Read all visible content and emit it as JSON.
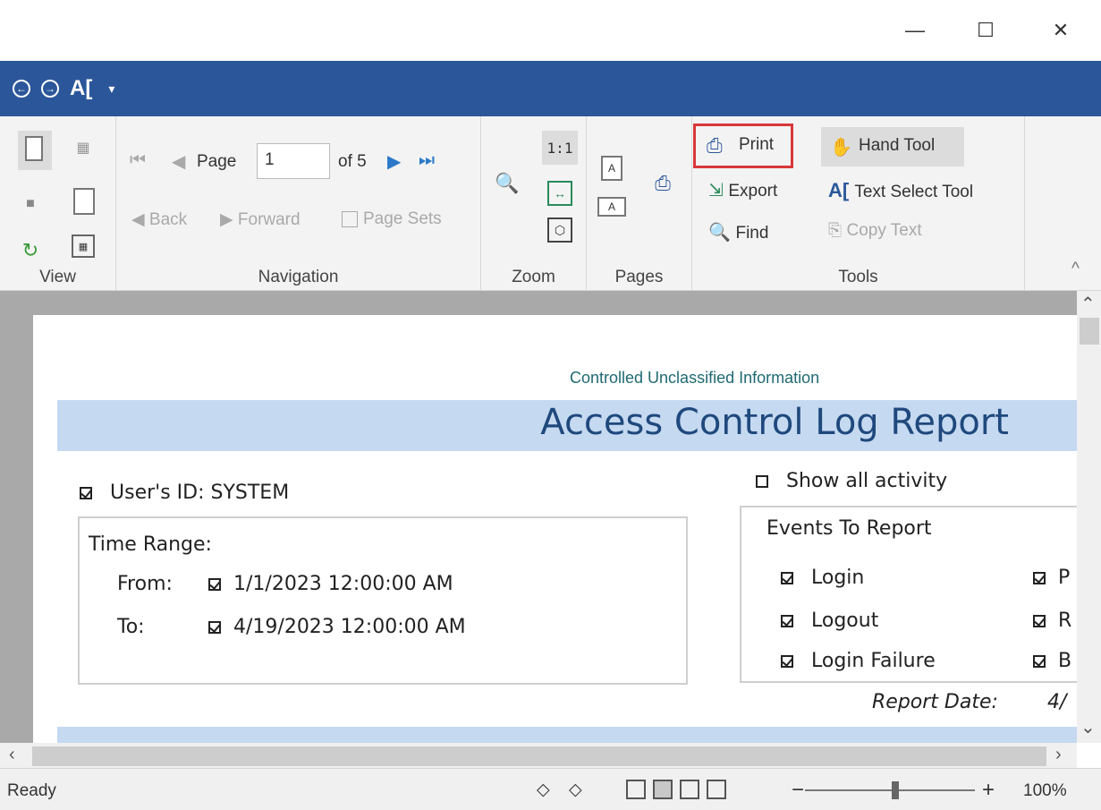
{
  "window": {
    "minimize": "—",
    "maximize": "☐",
    "close": "✕"
  },
  "qat": {
    "back": "←",
    "forward": "→",
    "text_tool": "A[",
    "dropdown": "▾"
  },
  "ribbon": {
    "groups": {
      "view": "View",
      "navigation": "Navigation",
      "zoom": "Zoom",
      "pages": "Pages",
      "tools": "Tools"
    },
    "navigation": {
      "page_label": "Page",
      "page_value": "1",
      "of_label": "of 5",
      "back": "Back",
      "forward": "Forward",
      "page_sets": "Page Sets"
    },
    "zoom": {
      "actual_size": "1:1"
    },
    "tools": {
      "print": "Print",
      "export": "Export",
      "find": "Find",
      "hand_tool": "Hand Tool",
      "text_select_tool": "Text Select Tool",
      "copy_text": "Copy Text"
    },
    "collapse": "^"
  },
  "document": {
    "classification": "Controlled Unclassified Information",
    "title": "Access Control Log Report",
    "user_id": "User's ID: SYSTEM",
    "show_all_activity": "Show all activity",
    "time_range": {
      "heading": "Time Range:",
      "from_label": "From:",
      "from_value": "1/1/2023 12:00:00 AM",
      "to_label": "To:",
      "to_value": "4/19/2023 12:00:00 AM"
    },
    "events": {
      "heading": "Events To Report",
      "items": [
        "Login",
        "Logout",
        "Login Failure"
      ],
      "right_items": [
        "P",
        "R",
        "B"
      ]
    },
    "report_date_label": "Report Date:",
    "report_date_value": "4/"
  },
  "status": {
    "text": "Ready",
    "zoom": "100%",
    "minus": "−",
    "plus": "+"
  }
}
